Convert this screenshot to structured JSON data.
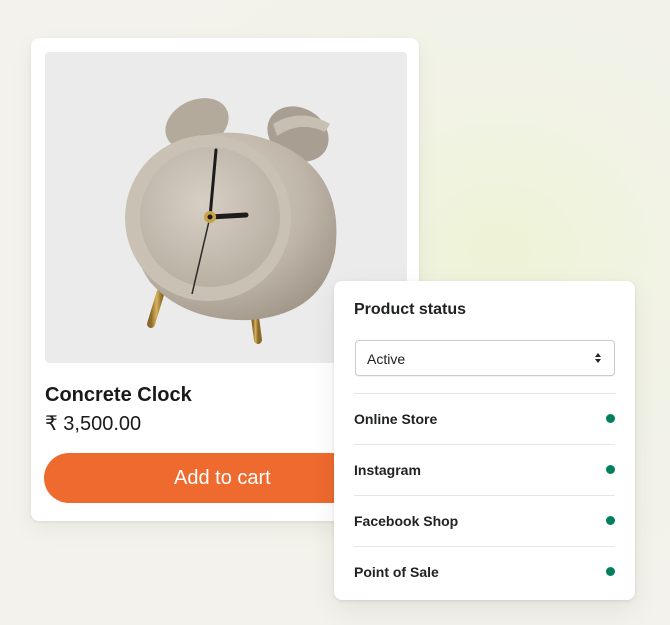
{
  "product": {
    "name": "Concrete Clock",
    "price": "₹ 3,500.00",
    "add_to_cart_label": "Add to cart",
    "image_icon": "concrete-alarm-clock"
  },
  "status_panel": {
    "title": "Product status",
    "status_value": "Active",
    "channels": [
      {
        "label": "Online Store",
        "active": true
      },
      {
        "label": "Instagram",
        "active": true
      },
      {
        "label": "Facebook Shop",
        "active": true
      },
      {
        "label": "Point of Sale",
        "active": true
      }
    ]
  },
  "colors": {
    "button": "#ee6a2f",
    "active_dot": "#007f5f",
    "text": "#1a1a1a"
  }
}
